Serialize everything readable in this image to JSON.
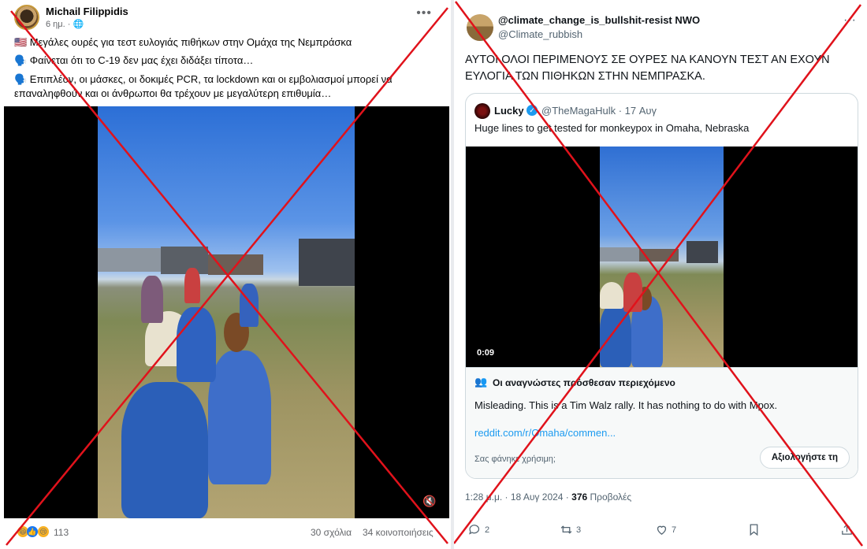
{
  "facebook": {
    "author": "Michail Filippidis",
    "time": "6 ημ. · ",
    "line1": "🇺🇸 Μεγάλες ουρές για τεστ ευλογιάς πιθήκων στην Ομάχα της Νεμπράσκα",
    "line2": "🗣️ Φαίνεται ότι το C-19 δεν μας έχει διδάξει τίποτα…",
    "line3": "🗣️ Επιπλέον, οι μάσκες, οι δοκιμές PCR, τα lockdown και οι εμβολιασμοί μπορεί να επαναληφθούν και οι άνθρωποι θα τρέχουν με μεγαλύτερη επιθυμία…",
    "reactions_count": "113",
    "comments": "30 σχόλια",
    "shares": "34 κοινοποιήσεις"
  },
  "twitter": {
    "name": "@climate_change_is_bullshit-resist NWO",
    "handle": "@Climate_rubbish",
    "text": "ΑΥΤΟΙ ΟΛΟΙ ΠΕΡΙΜΕΝΟΥΣ ΣΕ ΟΥΡΕΣ ΝΑ ΚΑΝΟΥΝ ΤΕΣΤ ΑΝ ΕΧΟΥΝ ΕΥΛΟΓΙΑ ΤΩΝ ΠΙΘΗΚΩΝ ΣΤΗΝ ΝΕΜΠΡΑΣΚΑ.",
    "quote": {
      "name": "Lucky",
      "handle": "@TheMagaHulk · 17 Αυγ",
      "text": "Huge lines to get tested for monkeypox in Omaha, Nebraska",
      "duration": "0:09"
    },
    "community_note": {
      "title": "Οι αναγνώστες πρόσθεσαν περιεχόμενο",
      "body": "Misleading. This is a Tim Walz rally. It has nothing to do with Mpox.",
      "link": "reddit.com/r/Omaha/commen...",
      "helpful_q": "Σας φάνηκε χρήσιμη;",
      "rate_label": "Αξιολογήστε τη"
    },
    "meta_time": "1:28 μ.μ. · 18 Αυγ 2024 · ",
    "views_count": "376",
    "views_label": " Προβολές",
    "replies": "2",
    "retweets": "3",
    "likes": "7"
  },
  "colors": {
    "cross": "#e0121b",
    "link": "#1d9bf0"
  },
  "icons": [
    "more-icon",
    "globe-icon",
    "mute-icon",
    "verified-icon",
    "notes-icon",
    "reply-icon",
    "retweet-icon",
    "like-icon",
    "bookmark-icon",
    "share-icon"
  ]
}
